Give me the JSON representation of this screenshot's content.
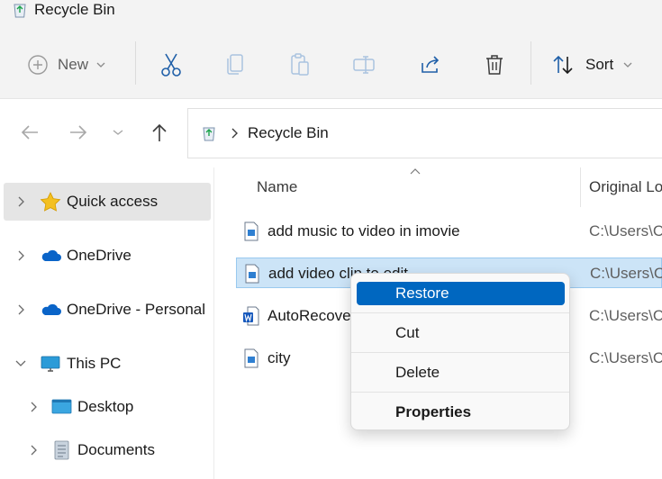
{
  "window": {
    "title": "Recycle Bin"
  },
  "toolbar": {
    "new_label": "New",
    "sort_label": "Sort",
    "buttons": [
      "cut",
      "copy",
      "paste",
      "rename",
      "share",
      "delete"
    ]
  },
  "address": {
    "breadcrumb": "Recycle Bin"
  },
  "sidebar": {
    "items": [
      {
        "label": "Quick access",
        "icon": "star-icon",
        "selected": true
      },
      {
        "label": "OneDrive",
        "icon": "cloud-icon"
      },
      {
        "label": "OneDrive - Personal",
        "icon": "cloud-icon"
      },
      {
        "label": "This PC",
        "icon": "computer-icon",
        "expanded": true
      },
      {
        "label": "Desktop",
        "icon": "desktop-folder-icon"
      },
      {
        "label": "Documents",
        "icon": "documents-folder-icon"
      }
    ]
  },
  "columns": {
    "name": "Name",
    "original_location": "Original Lo"
  },
  "files": [
    {
      "name": "add music to video in imovie",
      "original_location": "C:\\Users\\C",
      "icon": "image-file-icon"
    },
    {
      "name": "add video clip to edit",
      "original_location": "C:\\Users\\C",
      "icon": "image-file-icon",
      "selected": true
    },
    {
      "name": "AutoRecove",
      "original_location": "C:\\Users\\C",
      "icon": "word-file-icon"
    },
    {
      "name": "city",
      "original_location": "C:\\Users\\C",
      "icon": "image-file-icon"
    }
  ],
  "context_menu": {
    "items": [
      {
        "label": "Restore",
        "highlighted": true
      },
      {
        "label": "Cut"
      },
      {
        "label": "Delete"
      },
      {
        "label": "Properties",
        "bold": true
      }
    ]
  },
  "colors": {
    "accent": "#0067c0",
    "selection": "#cce4f7",
    "onedrive": "#0a64c8"
  }
}
